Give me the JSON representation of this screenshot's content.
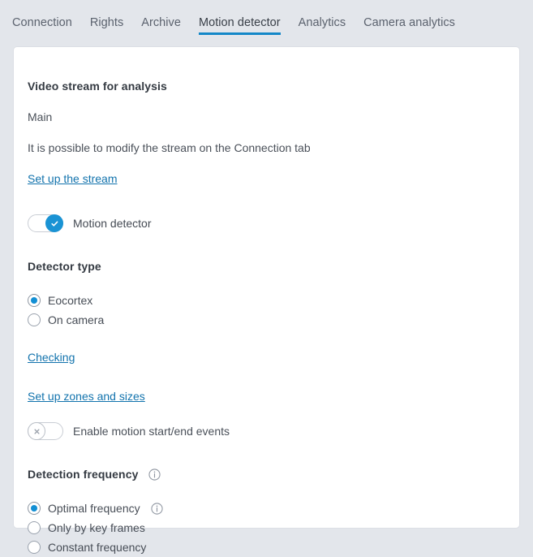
{
  "tabs": [
    {
      "label": "Connection",
      "active": false
    },
    {
      "label": "Rights",
      "active": false
    },
    {
      "label": "Archive",
      "active": false
    },
    {
      "label": "Motion detector",
      "active": true
    },
    {
      "label": "Analytics",
      "active": false
    },
    {
      "label": "Camera analytics",
      "active": false
    }
  ],
  "colors": {
    "page_background": "#e3e6eb",
    "card_background": "#ffffff",
    "accent_blue": "#1488c8",
    "link_blue": "#1273ad",
    "toggle_on": "#1a93d4",
    "radio_dot": "#138fd4"
  },
  "video_stream": {
    "heading": "Video stream for analysis",
    "stream_name": "Main",
    "hint": "It is possible to modify the stream on the Connection tab",
    "link_label": "Set up the stream"
  },
  "motion_detector_toggle": {
    "label": "Motion detector",
    "state": "on",
    "icon": "check-icon"
  },
  "detector_type": {
    "heading": "Detector type",
    "options": [
      {
        "label": "Eocortex",
        "selected": true
      },
      {
        "label": "On camera",
        "selected": false
      }
    ],
    "checking_link": "Checking",
    "zones_link": "Set up zones and sizes"
  },
  "motion_events_toggle": {
    "label": "Enable motion start/end events",
    "state": "off",
    "icon": "cross-icon"
  },
  "detection_frequency": {
    "heading": "Detection frequency",
    "heading_info_icon": "info-icon",
    "options": [
      {
        "label": "Optimal frequency",
        "selected": true,
        "info_icon": "info-icon"
      },
      {
        "label": "Only by key frames",
        "selected": false,
        "info_icon": null
      },
      {
        "label": "Constant frequency",
        "selected": false,
        "info_icon": null
      }
    ]
  }
}
